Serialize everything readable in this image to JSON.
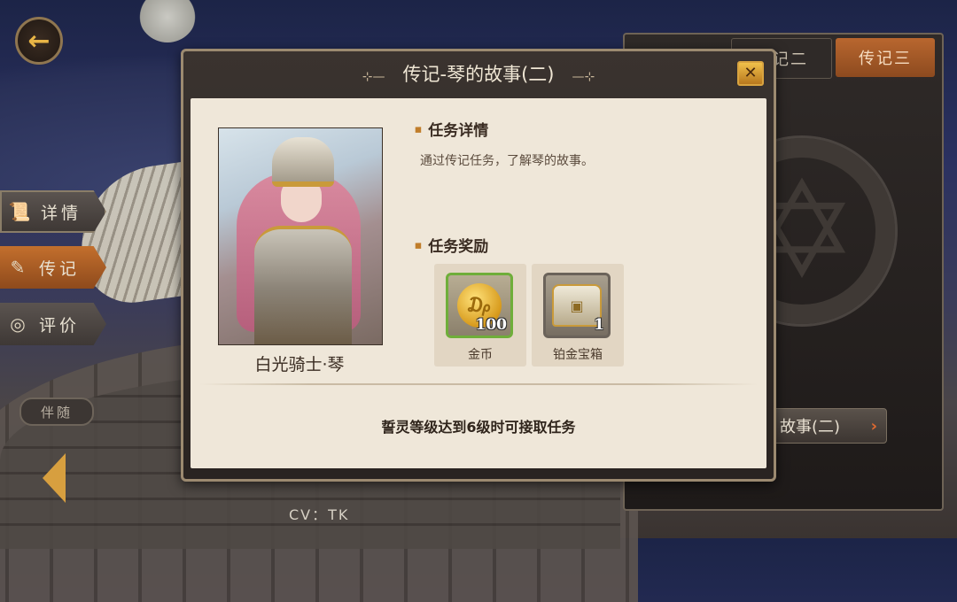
{
  "background": {
    "side_tabs": [
      {
        "label": "详情",
        "icon": "scroll-icon"
      },
      {
        "label": "传记",
        "icon": "feather-icon"
      },
      {
        "label": "评价",
        "icon": "spiral-icon"
      }
    ],
    "companion_label": "伴随",
    "cv_text": "CV：TK",
    "right_panel": {
      "tab2_label": "传记二",
      "tab3_label": "传记三",
      "story_button_label": "故事(二)"
    }
  },
  "dialog": {
    "title": "传记-琴的故事(二)",
    "close_icon": "close-icon",
    "hero_name": "白光骑士·琴",
    "task_detail_heading": "任务详情",
    "task_detail_text": "通过传记任务，了解琴的故事。",
    "reward_heading": "任务奖励",
    "rewards": [
      {
        "name": "金币",
        "quantity": "100",
        "icon": "gold-coin-icon",
        "border_color": "#6fae3a"
      },
      {
        "name": "铂金宝箱",
        "quantity": "1",
        "icon": "treasure-chest-icon",
        "border_color": "#6b635a"
      }
    ],
    "requirement_text": "誓灵等级达到6级时可接取任务"
  },
  "colors": {
    "accent": "#c36f2d",
    "gold": "#d8a340"
  }
}
